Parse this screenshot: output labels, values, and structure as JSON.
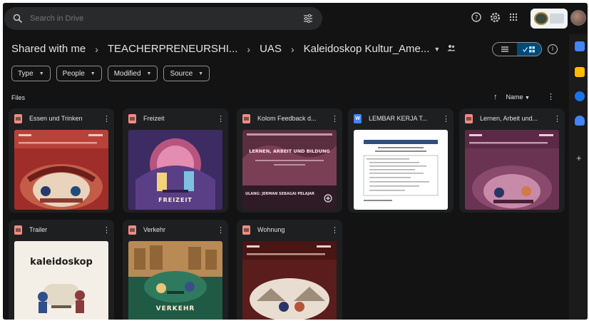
{
  "search": {
    "placeholder": "Search in Drive"
  },
  "breadcrumb": {
    "root": "Shared with me",
    "level1": "TEACHERPRENEURSHI...",
    "level2": "UAS",
    "current": "Kaleidoskop Kultur_Ame..."
  },
  "filters": [
    "Type",
    "People",
    "Modified",
    "Source"
  ],
  "section_label": "Files",
  "sort_label": "Name",
  "files": [
    {
      "name": "Essen und Trinken",
      "type": "slides"
    },
    {
      "name": "Freizeit",
      "type": "slides",
      "thumb_text": "FREIZEIT"
    },
    {
      "name": "Kolom Feedback d...",
      "type": "slides",
      "thumb_text": "LERNEN, ARBEIT UND BILDUNG",
      "thumb_footer": "ULANG: JERMAN SEBAGAI PELAJAR"
    },
    {
      "name": "LEMBAR KERJA T...",
      "type": "doc"
    },
    {
      "name": "Lernen, Arbeit und...",
      "type": "slides"
    },
    {
      "name": "Trailer",
      "type": "slides",
      "thumb_text": "kaleidoskop"
    },
    {
      "name": "Verkehr",
      "type": "slides",
      "thumb_text": "VERKEHR"
    },
    {
      "name": "Wohnung",
      "type": "slides"
    }
  ],
  "colors": {
    "background": "#131314",
    "surface": "#1e1f20",
    "accent": "#c2e7ff",
    "slides": "#f28b82",
    "doc": "#4285f4"
  },
  "icons": {
    "search": "search-icon",
    "tune": "tune-icon",
    "help": "help-icon",
    "settings": "settings-icon",
    "apps": "apps-icon",
    "info": "info-icon"
  }
}
